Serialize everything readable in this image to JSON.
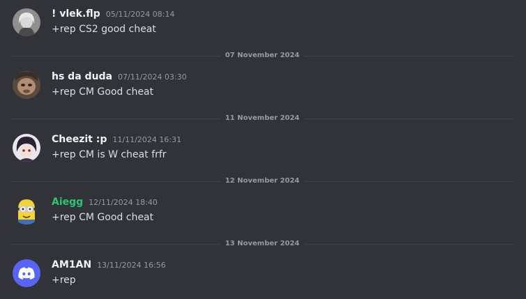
{
  "messages": [
    {
      "username": "! vlek.flp",
      "timestamp": "05/11/2024 08:14",
      "content": "+rep CS2 good cheat"
    },
    {
      "username": "hs da duda",
      "timestamp": "07/11/2024 03:30",
      "content": "+rep CM Good cheat"
    },
    {
      "username": "Cheezit :p",
      "timestamp": "11/11/2024 16:31",
      "content": "+rep CM is W cheat frfr"
    },
    {
      "username": "Aiegg",
      "timestamp": "12/11/2024 18:40",
      "content": "+rep CM Good cheat",
      "name_color": "#2dc770"
    },
    {
      "username": "AM1AN",
      "timestamp": "13/11/2024 16:56",
      "content": "+rep"
    }
  ],
  "dividers": [
    "07 November 2024",
    "11 November 2024",
    "12 November 2024",
    "13 November 2024"
  ],
  "colors": {
    "background": "#313338",
    "username": "#f2f3f5",
    "text": "#dbdee1",
    "muted": "#949ba4",
    "discord_blurple": "#5865f2"
  }
}
